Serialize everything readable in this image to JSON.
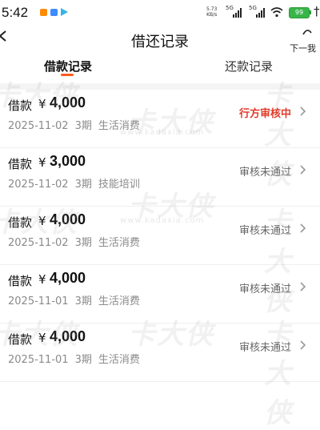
{
  "status_bar": {
    "time": "5:42",
    "net_speed": "5.73",
    "net_unit": "KB/s",
    "signal1_label": "5G",
    "signal2_label": "5G",
    "battery": "99",
    "truncated_icon_text": "†"
  },
  "header": {
    "title": "借还记录",
    "next_label": "下一我"
  },
  "tabs": [
    {
      "label": "借款记录",
      "active": true
    },
    {
      "label": "还款记录",
      "active": false
    }
  ],
  "records": [
    {
      "label": "借款",
      "currency": "¥",
      "amount": "4,000",
      "date": "2025-11-02",
      "term": "3期",
      "purpose": "生活消费",
      "status": "行方审核中",
      "status_color": "#e23b2b"
    },
    {
      "label": "借款",
      "currency": "¥",
      "amount": "3,000",
      "date": "2025-11-02",
      "term": "3期",
      "purpose": "技能培训",
      "status": "审核未通过",
      "status_color": "#666666"
    },
    {
      "label": "借款",
      "currency": "¥",
      "amount": "4,000",
      "date": "2025-11-02",
      "term": "3期",
      "purpose": "生活消费",
      "status": "审核未通过",
      "status_color": "#666666"
    },
    {
      "label": "借款",
      "currency": "¥",
      "amount": "4,000",
      "date": "2025-11-01",
      "term": "3期",
      "purpose": "生活消费",
      "status": "审核未通过",
      "status_color": "#666666"
    },
    {
      "label": "借款",
      "currency": "¥",
      "amount": "4,000",
      "date": "2025-11-01",
      "term": "3期",
      "purpose": "生活消费",
      "status": "审核未通过",
      "status_color": "#666666"
    }
  ],
  "watermark": {
    "text": "卡大侠",
    "url": "www.kadaxia.com"
  },
  "colors": {
    "accent": "#ff5a1f",
    "status_pending": "#e23b2b"
  }
}
